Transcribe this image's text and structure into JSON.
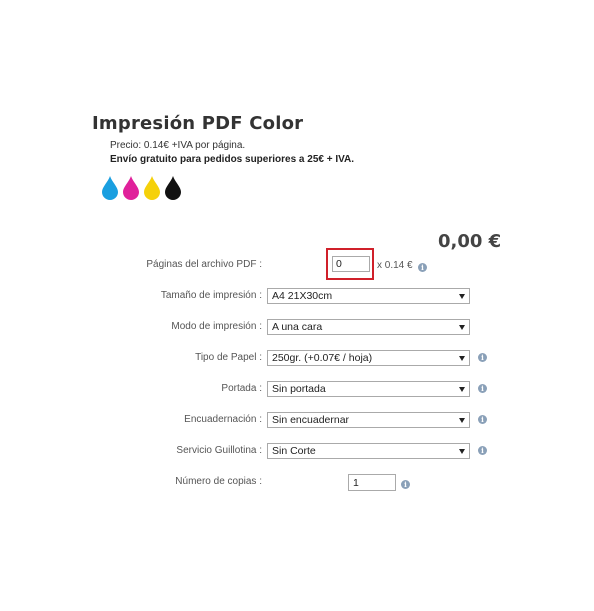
{
  "product": {
    "title": "Impresión PDF Color",
    "price_line": "Precio: 0.14€ +IVA por página.",
    "shipping_line": "Envío gratuito para pedidos superiores a 25€ + IVA.",
    "ink_drops": [
      {
        "name": "cyan",
        "color": "#1a9fe0"
      },
      {
        "name": "magenta",
        "color": "#e0219b"
      },
      {
        "name": "yellow",
        "color": "#f5d10a"
      },
      {
        "name": "black",
        "color": "#111111"
      }
    ]
  },
  "total": "0,00 €",
  "form": {
    "pages": {
      "label": "Páginas del archivo PDF :",
      "value": "0",
      "unit_price": "x 0.14 €"
    },
    "size": {
      "label": "Tamaño de impresión :",
      "selected": "A4 21X30cm"
    },
    "mode": {
      "label": "Modo de impresión :",
      "selected": "A una cara"
    },
    "paper": {
      "label": "Tipo de Papel :",
      "selected": "250gr. (+0.07€ / hoja)"
    },
    "cover": {
      "label": "Portada :",
      "selected": "Sin portada"
    },
    "binding": {
      "label": "Encuadernación :",
      "selected": "Sin encuadernar"
    },
    "guillotine": {
      "label": "Servicio Guillotina :",
      "selected": "Sin Corte"
    },
    "copies": {
      "label": "Número de copias :",
      "value": "1"
    }
  },
  "colors": {
    "highlight_border": "#d0202a",
    "info_icon": "#8aa0b8"
  }
}
